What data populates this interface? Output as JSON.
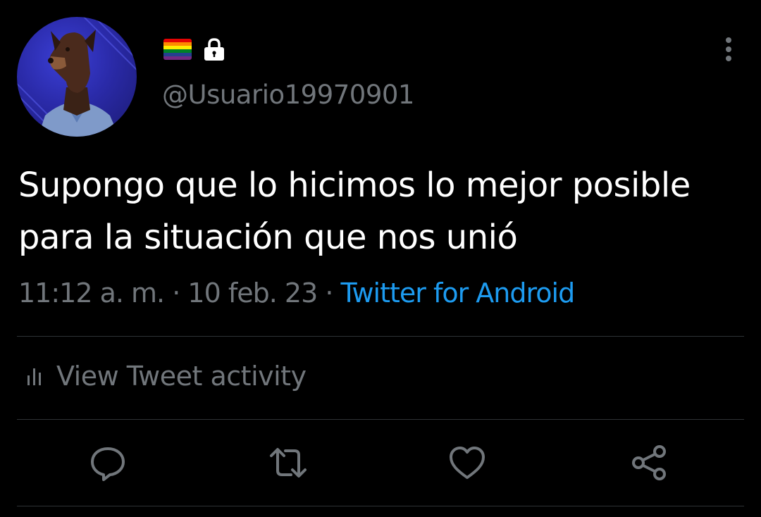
{
  "profile": {
    "avatar_alt": "Doberman wearing a blue shirt",
    "flag_colors": [
      "#e40303",
      "#ff8c00",
      "#ffed00",
      "#008026",
      "#24408e",
      "#732982"
    ],
    "handle": "@Usuario19970901"
  },
  "tweet": {
    "text": "Supongo que lo hicimos lo mejor posible para la situación que nos unió",
    "time": "11:12 a. m.",
    "separator": "·",
    "date": "10 feb. 23",
    "source": "Twitter for Android"
  },
  "activity": {
    "label": "View Tweet activity"
  },
  "actions": [
    {
      "name": "reply",
      "icon": "reply-icon"
    },
    {
      "name": "retweet",
      "icon": "retweet-icon"
    },
    {
      "name": "like",
      "icon": "heart-icon"
    },
    {
      "name": "share",
      "icon": "share-icon"
    }
  ],
  "colors": {
    "background": "#000000",
    "text_primary": "#ffffff",
    "text_secondary": "#71767b",
    "link": "#1d9bf0",
    "divider": "#2f3336"
  }
}
